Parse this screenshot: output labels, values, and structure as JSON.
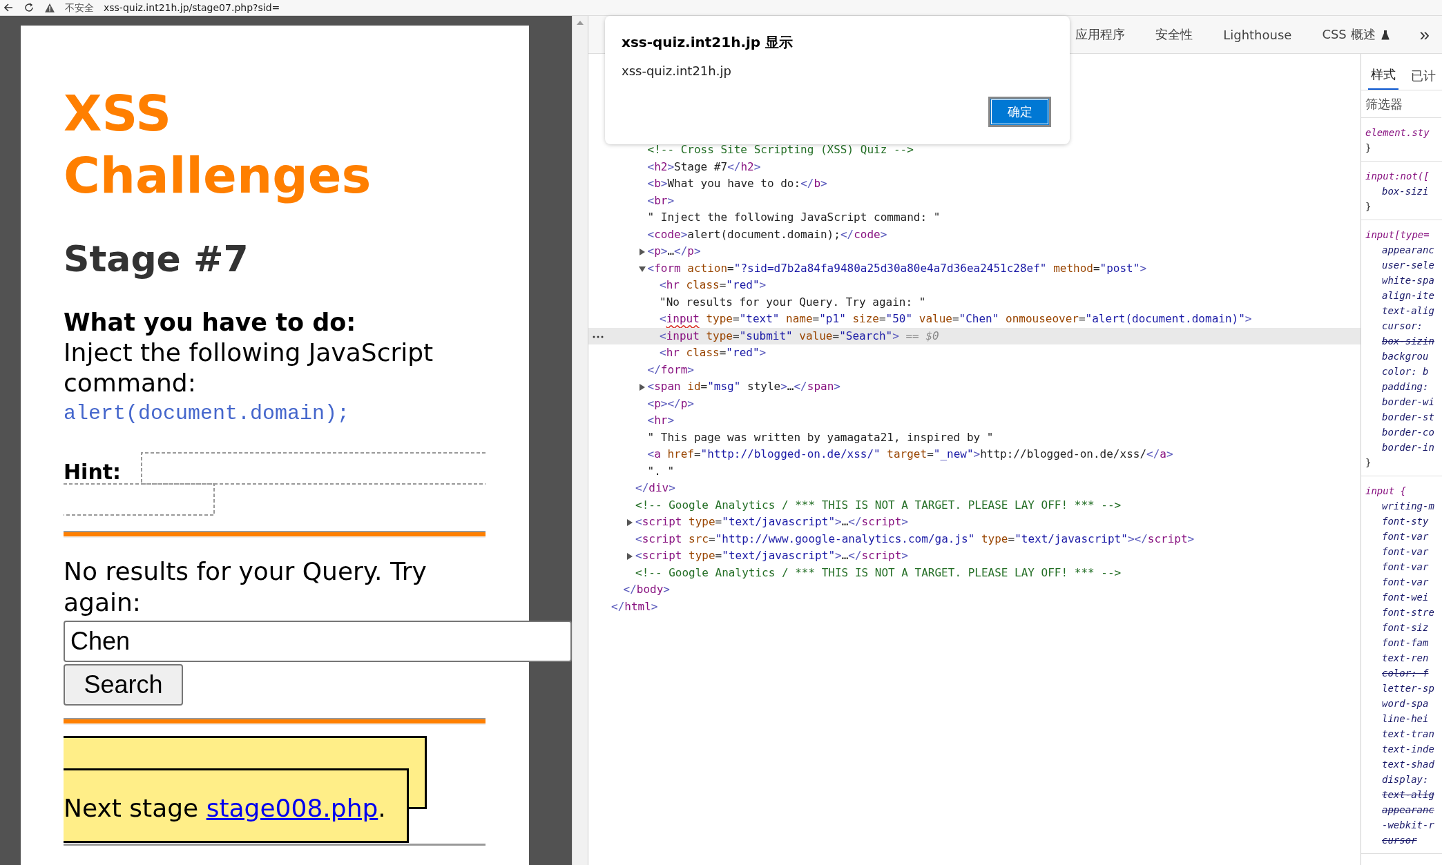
{
  "browser": {
    "security_label": "不安全",
    "url": "xss-quiz.int21h.jp/stage07.php?sid="
  },
  "page": {
    "title": "XSS Challenges",
    "stage": "Stage #7",
    "task_heading": "What you have to do:",
    "task_text": "Inject the following JavaScript command:",
    "command": "alert(document.domain);",
    "hint_label": "Hint:",
    "result_text": "No results for your Query. Try again:",
    "query_value": "Chen",
    "search_button": "Search",
    "next_stage": {
      "prefix": "Next stage ",
      "link": "stage008.php",
      "suffix": "."
    }
  },
  "devtools": {
    "tabs": [
      {
        "label": "应用程序",
        "selected": false,
        "kind": "plain"
      },
      {
        "label": "安全性",
        "selected": false,
        "kind": "plain"
      },
      {
        "label": "Lighthouse",
        "selected": false,
        "kind": "plain"
      },
      {
        "label": "CSS 概述",
        "selected": false,
        "kind": "experimental"
      }
    ],
    "overflow": "»",
    "dom_tree": {
      "close": "</html>",
      "children": [
        {
          "close": "</body>",
          "children": [
            {
              "close": "</div>",
              "children": [
                {
                  "kind": "comment",
                  "open": "<!-- Cross Site Scripting (XSS) Quiz -->",
                  "selected": false
                },
                {
                  "kind": "element",
                  "open": "<h2>Stage #7</h2>",
                  "selected": false
                },
                {
                  "kind": "element",
                  "open": "<b>What you have to do:</b>",
                  "selected": false
                },
                {
                  "kind": "element",
                  "open": "<br>",
                  "selected": false
                },
                {
                  "kind": "text",
                  "open": "\" Inject the following JavaScript command: \"",
                  "selected": false
                },
                {
                  "kind": "element",
                  "open": "<code>alert(document.domain);</code>",
                  "selected": false
                },
                {
                  "kind": "element",
                  "open": "<p>…</p>",
                  "expanded": false,
                  "selected": false
                },
                {
                  "kind": "element",
                  "open": "<form action=\"?sid=d7b2a84fa9480a25d30a80e4a7d36ea2451c28ef\" method=\"post\">",
                  "expanded": true,
                  "selected": false,
                  "close": "</form>",
                  "children": [
                    {
                      "kind": "element",
                      "open": "<hr class=\"red\">",
                      "selected": false
                    },
                    {
                      "kind": "text",
                      "open": "\"No results for your Query. Try again: \"",
                      "selected": false
                    },
                    {
                      "kind": "element",
                      "open": "<input type=\"text\" name=\"p1\" size=\"50\" value=\"Chen\" onmouseover=\"alert(document.domain)\">",
                      "selected": false,
                      "issue": true
                    },
                    {
                      "kind": "element",
                      "open": "<input type=\"submit\" value=\"Search\">",
                      "selected": true,
                      "suffix": "== $0"
                    },
                    {
                      "kind": "element",
                      "open": "<hr class=\"red\">",
                      "selected": false
                    }
                  ]
                },
                {
                  "kind": "element",
                  "open": "<span id=\"msg\" style>…</span>",
                  "expanded": false,
                  "selected": false
                },
                {
                  "kind": "element",
                  "open": "<p></p>",
                  "selected": false
                },
                {
                  "kind": "element",
                  "open": "<hr>",
                  "selected": false
                },
                {
                  "kind": "text",
                  "open": "\" This page was written by yamagata21, inspired by \"",
                  "selected": false
                },
                {
                  "kind": "element",
                  "open": "<a href=\"http://blogged-on.de/xss/\" target=\"_new\">http://blogged-on.de/xss/</a>",
                  "selected": false
                },
                {
                  "kind": "text",
                  "open": "\". \"",
                  "selected": false
                }
              ]
            },
            {
              "kind": "comment",
              "open": "<!-- Google Analytics / *** THIS IS NOT A TARGET. PLEASE LAY OFF! *** -->",
              "selected": false
            },
            {
              "kind": "element",
              "open": "<script type=\"text/javascript\">…</script>",
              "expanded": false,
              "selected": false
            },
            {
              "kind": "element",
              "open": "<script src=\"http://www.google-analytics.com/ga.js\" type=\"text/javascript\"></script>",
              "selected": false
            },
            {
              "kind": "element",
              "open": "<script type=\"text/javascript\">…</script>",
              "expanded": false,
              "selected": false
            },
            {
              "kind": "comment",
              "open": "<!-- Google Analytics / *** THIS IS NOT A TARGET. PLEASE LAY OFF! *** -->",
              "selected": false
            }
          ]
        }
      ]
    },
    "styles": {
      "tabs": [
        {
          "label": "样式",
          "selected": true
        },
        {
          "label": "已计",
          "selected": false
        }
      ],
      "filter_placeholder": "筛选器",
      "rules": [
        {
          "selector": "element.sty",
          "close": "}"
        },
        {
          "selector": "input:not([",
          "props": [
            {
              "text": "box-sizi",
              "struck": false
            }
          ],
          "close": "}"
        },
        {
          "selector": "input[type=",
          "props": [
            {
              "text": "appearanc",
              "struck": false
            },
            {
              "text": "user-sele",
              "struck": false
            },
            {
              "text": "white-spa",
              "struck": false
            },
            {
              "text": "align-ite",
              "struck": false
            },
            {
              "text": "text-alig",
              "struck": false
            },
            {
              "text": "cursor:",
              "struck": false
            },
            {
              "text": "box-sizin",
              "struck": true
            },
            {
              "text": "backgrou",
              "struck": false
            },
            {
              "text": "color: b",
              "struck": false
            },
            {
              "text": "padding:",
              "struck": false
            },
            {
              "text": "border-wi",
              "struck": false
            },
            {
              "text": "border-st",
              "struck": false
            },
            {
              "text": "border-co",
              "struck": false
            },
            {
              "text": "border-in",
              "struck": false
            }
          ],
          "close": "}"
        },
        {
          "selector": "input {",
          "props": [
            {
              "text": "writing-m",
              "struck": false
            },
            {
              "text": "font-sty",
              "struck": false
            },
            {
              "text": "font-var",
              "struck": false
            },
            {
              "text": "font-var",
              "struck": false
            },
            {
              "text": "font-var",
              "struck": false
            },
            {
              "text": "font-var",
              "struck": false
            },
            {
              "text": "font-wei",
              "struck": false
            },
            {
              "text": "font-stre",
              "struck": false
            },
            {
              "text": "font-siz",
              "struck": false
            },
            {
              "text": "font-fam",
              "struck": false
            },
            {
              "text": "text-ren",
              "struck": false
            },
            {
              "text": "color: f",
              "struck": true
            },
            {
              "text": "letter-sp",
              "struck": false
            },
            {
              "text": "word-spa",
              "struck": false
            },
            {
              "text": "line-hei",
              "struck": false
            },
            {
              "text": "text-tran",
              "struck": false
            },
            {
              "text": "text-inde",
              "struck": false
            },
            {
              "text": "text-shad",
              "struck": false
            },
            {
              "text": "display:",
              "struck": false
            },
            {
              "text": "text-alig",
              "struck": true
            },
            {
              "text": "appearanc",
              "struck": true
            },
            {
              "text": "-webkit-r",
              "struck": false
            },
            {
              "text": "cursor",
              "struck": true
            }
          ]
        }
      ]
    }
  },
  "dialog": {
    "title": "xss-quiz.int21h.jp 显示",
    "message": "xss-quiz.int21h.jp",
    "ok": "确定"
  }
}
